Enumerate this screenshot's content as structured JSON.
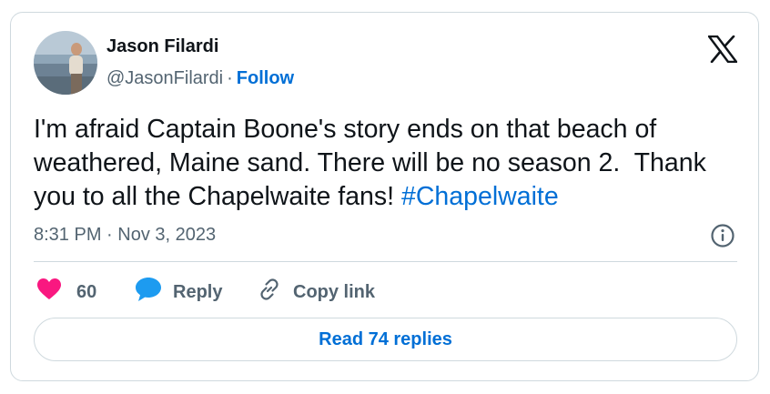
{
  "author": {
    "name": "Jason Filardi",
    "handle": "@JasonFilardi",
    "separator": "·",
    "follow_label": "Follow"
  },
  "tweet": {
    "text": "I'm afraid Captain Boone's story ends on that beach of weathered, Maine sand. There will be no season 2.  Thank you to all the Chapelwaite fans! ",
    "hashtag": "#Chapelwaite",
    "time": "8:31 PM",
    "separator": "·",
    "date": "Nov 3, 2023"
  },
  "actions": {
    "like_count": "60",
    "reply_label": "Reply",
    "copy_label": "Copy link"
  },
  "footer": {
    "read_replies_label": "Read 74 replies"
  },
  "icons": {
    "brand": "x-logo-icon",
    "like": "heart-icon",
    "reply": "speech-bubble-icon",
    "copy": "link-icon",
    "info": "info-icon"
  },
  "colors": {
    "like": "#f91880",
    "reply": "#1d9bf0",
    "link": "#006fd6",
    "muted": "#536471",
    "text": "#0f1419",
    "border": "#cfd9de"
  }
}
